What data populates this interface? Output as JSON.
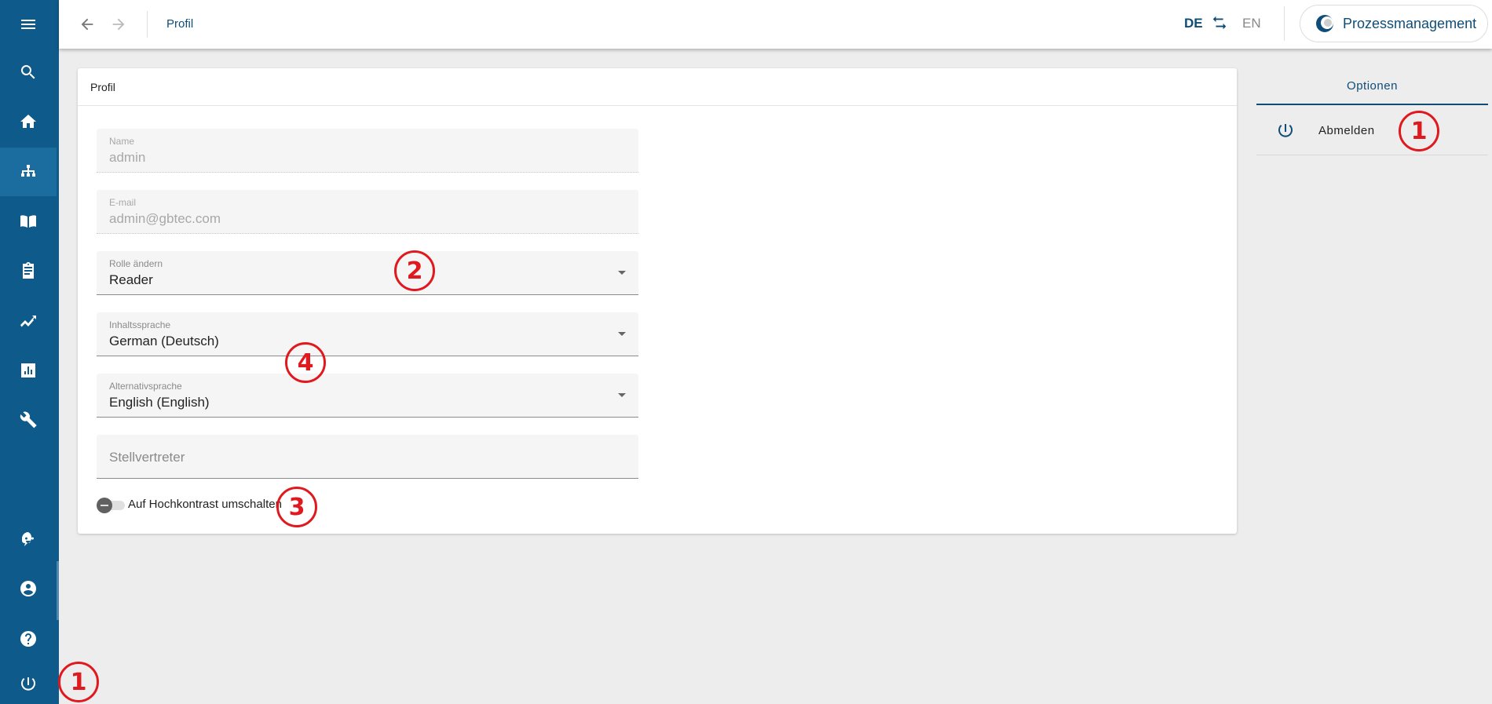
{
  "sidebar": {
    "items": [
      {
        "name": "menu-icon"
      },
      {
        "name": "search-icon"
      },
      {
        "name": "home-icon"
      },
      {
        "name": "process-tree-icon",
        "active": true
      },
      {
        "name": "book-icon"
      },
      {
        "name": "clipboard-icon"
      },
      {
        "name": "analytics-icon"
      },
      {
        "name": "bar-chart-icon"
      },
      {
        "name": "wrench-icon"
      },
      {
        "name": "assistant-icon"
      },
      {
        "name": "account-icon"
      },
      {
        "name": "help-icon"
      },
      {
        "name": "power-icon"
      }
    ]
  },
  "header": {
    "back_icon": "arrow-left-icon",
    "forward_icon": "arrow-right-icon",
    "breadcrumb": "Profil",
    "lang_active": "DE",
    "lang_other": "EN",
    "app_name": "Prozessmanagement"
  },
  "profile": {
    "title": "Profil",
    "name_label": "Name",
    "name_value": "admin",
    "email_label": "E-mail",
    "email_value": "admin@gbtec.com",
    "role_label": "Rolle ändern",
    "role_value": "Reader",
    "content_lang_label": "Inhaltssprache",
    "content_lang_value": "German (Deutsch)",
    "alt_lang_label": "Alternativsprache",
    "alt_lang_value": "English (English)",
    "deputy_placeholder": "Stellvertreter",
    "contrast_label": "Auf Hochkontrast umschalten",
    "contrast_on": false
  },
  "options": {
    "tab_label": "Optionen",
    "logout_label": "Abmelden"
  },
  "annotations": {
    "m1": "1",
    "m2": "2",
    "m3": "3",
    "m4": "4",
    "m5": "1"
  },
  "colors": {
    "sidebar": "#0e5a8a",
    "accent": "#0e4d78",
    "marker": "#e0191f"
  }
}
